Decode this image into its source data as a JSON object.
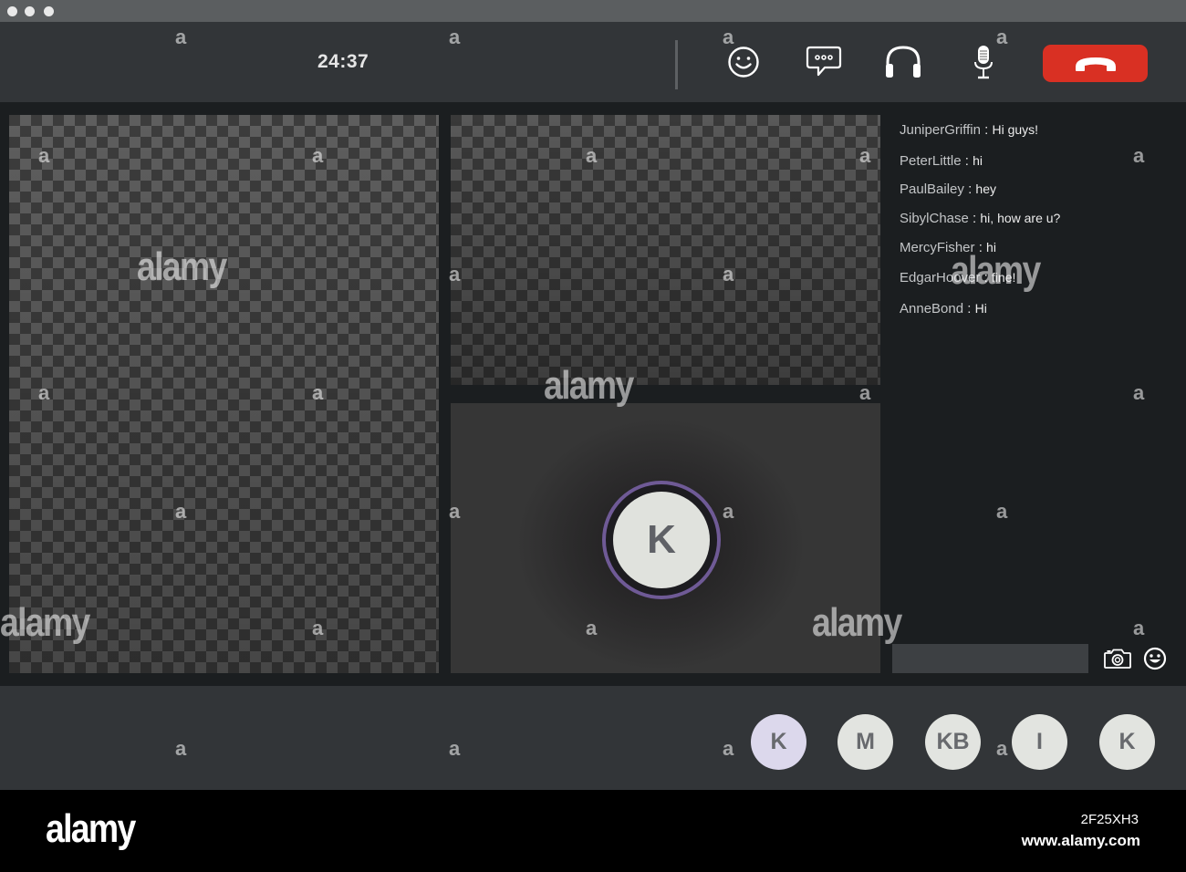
{
  "call": {
    "timer": "24:37"
  },
  "toolbar": {
    "buttons": [
      {
        "name": "emoji-button",
        "icon": "smiley-icon"
      },
      {
        "name": "chat-button",
        "icon": "speech-bubble-icon"
      },
      {
        "name": "audio-button",
        "icon": "headphones-icon"
      },
      {
        "name": "microphone-button",
        "icon": "microphone-icon"
      },
      {
        "name": "end-call-button",
        "icon": "phone-hangup-icon"
      }
    ],
    "end_call_color": "#d93023"
  },
  "video": {
    "active_speaker": {
      "initial": "K",
      "ring_color": "#6f5a96"
    }
  },
  "chat": {
    "messages": [
      {
        "user": "JuniperGriffin",
        "text": "Hi guys!"
      },
      {
        "user": "PeterLittle",
        "text": "hi"
      },
      {
        "user": "PaulBailey",
        "text": "hey"
      },
      {
        "user": "SibylChase",
        "text": "hi, how are u?"
      },
      {
        "user": "MercyFisher",
        "text": "hi"
      },
      {
        "user": "EdgarHoover",
        "text": "fine!"
      },
      {
        "user": "AnneBond",
        "text": "Hi"
      }
    ],
    "separator": ":",
    "input_value": "",
    "icons": [
      "camera-icon",
      "smiley-icon"
    ]
  },
  "participants": [
    {
      "initials": "K",
      "active": true
    },
    {
      "initials": "M",
      "active": false
    },
    {
      "initials": "KB",
      "active": false
    },
    {
      "initials": "I",
      "active": false
    },
    {
      "initials": "K",
      "active": false
    }
  ],
  "watermark": {
    "logo": "alamy",
    "glyph": "a",
    "image_id": "2F25XH3",
    "url": "www.alamy.com"
  }
}
